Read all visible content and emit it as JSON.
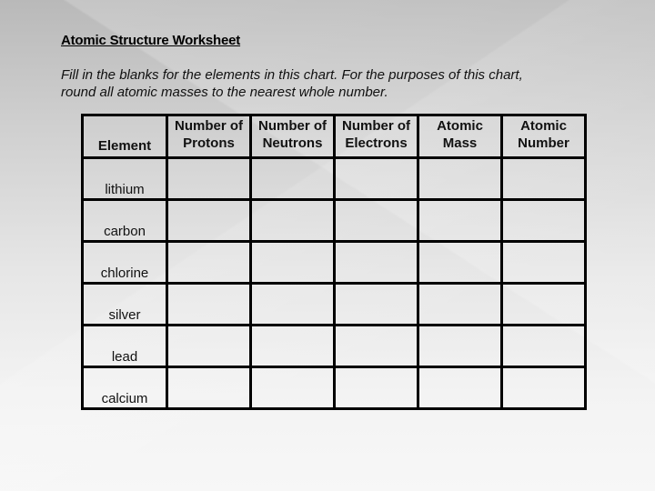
{
  "worksheet": {
    "title": "Atomic Structure Worksheet",
    "instructions": [
      "Fill in the blanks for the elements in this chart.  For the purposes of this chart,",
      "round all atomic masses to the nearest whole number."
    ],
    "table": {
      "headers": [
        {
          "line1": "",
          "line2": "Element"
        },
        {
          "line1": "Number of",
          "line2": "Protons"
        },
        {
          "line1": "Number of",
          "line2": "Neutrons"
        },
        {
          "line1": "Number of",
          "line2": "Electrons"
        },
        {
          "line1": "Atomic",
          "line2": "Mass"
        },
        {
          "line1": "Atomic",
          "line2": "Number"
        }
      ],
      "rows": [
        {
          "element": "lithium",
          "protons": "",
          "neutrons": "",
          "electrons": "",
          "atomic_mass": "",
          "atomic_number": ""
        },
        {
          "element": "carbon",
          "protons": "",
          "neutrons": "",
          "electrons": "",
          "atomic_mass": "",
          "atomic_number": ""
        },
        {
          "element": "chlorine",
          "protons": "",
          "neutrons": "",
          "electrons": "",
          "atomic_mass": "",
          "atomic_number": ""
        },
        {
          "element": "silver",
          "protons": "",
          "neutrons": "",
          "electrons": "",
          "atomic_mass": "",
          "atomic_number": ""
        },
        {
          "element": "lead",
          "protons": "",
          "neutrons": "",
          "electrons": "",
          "atomic_mass": "",
          "atomic_number": ""
        },
        {
          "element": "calcium",
          "protons": "",
          "neutrons": "",
          "electrons": "",
          "atomic_mass": "",
          "atomic_number": ""
        }
      ]
    }
  }
}
